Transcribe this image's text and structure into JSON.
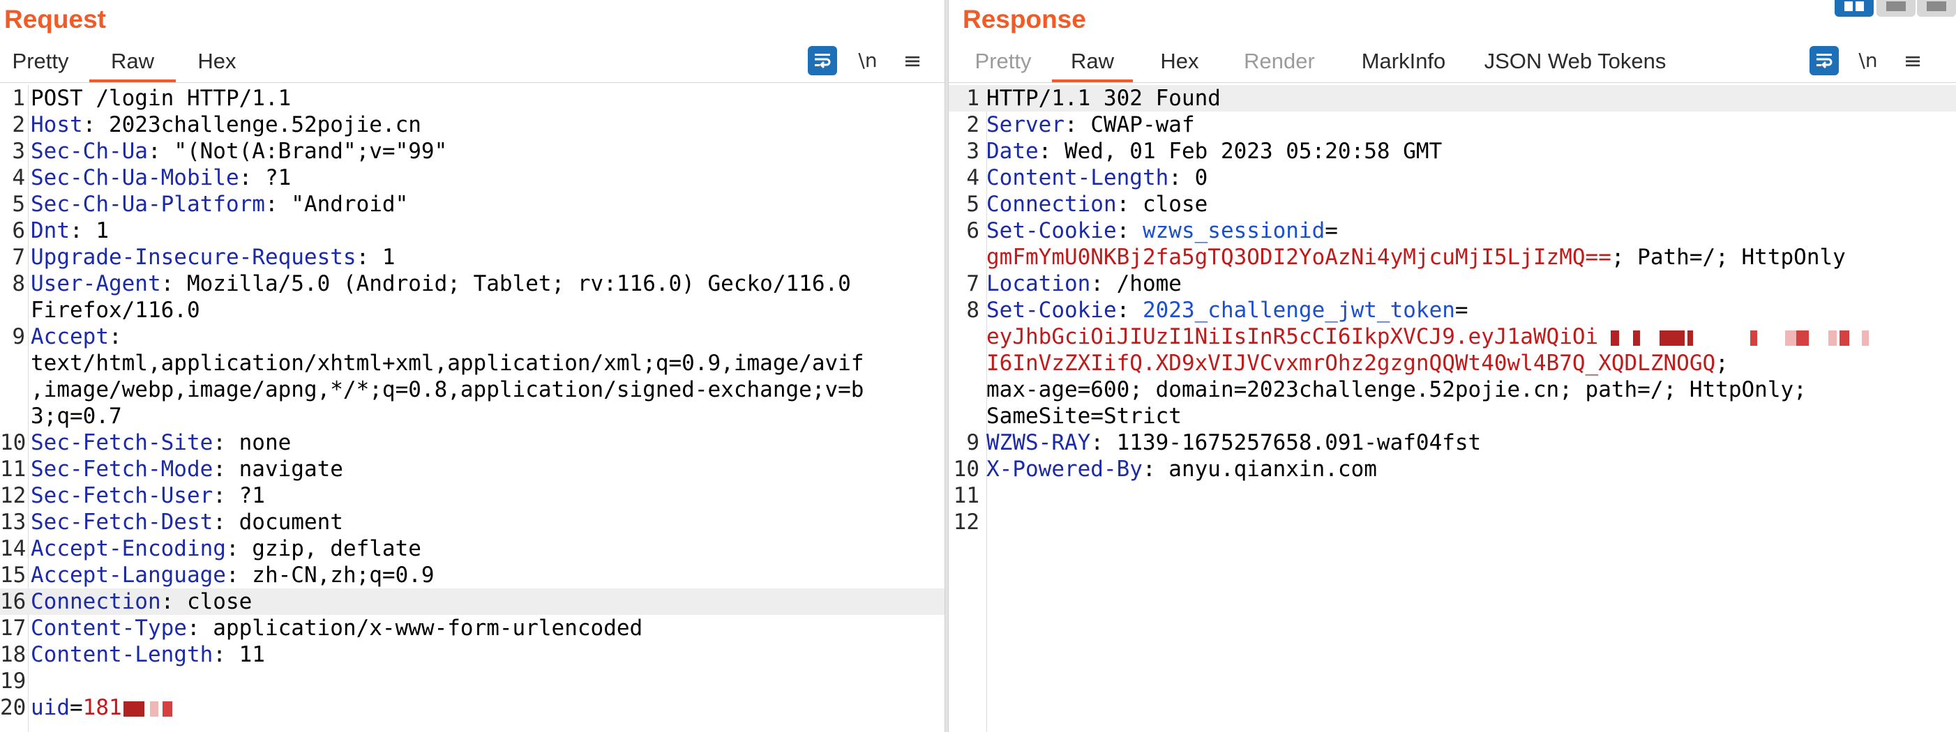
{
  "request": {
    "title": "Request",
    "tabs": [
      {
        "label": "Pretty",
        "active": false
      },
      {
        "label": "Raw",
        "active": true
      },
      {
        "label": "Hex",
        "active": false
      }
    ],
    "newline_label": "\\n",
    "menu_glyph": "≡",
    "request_line": "POST /login HTTP/1.1",
    "headers": [
      {
        "n": 2,
        "name": "Host",
        "value": "2023challenge.52pojie.cn"
      },
      {
        "n": 3,
        "name": "Sec-Ch-Ua",
        "value": "\"(Not(A:Brand\";v=\"99\""
      },
      {
        "n": 4,
        "name": "Sec-Ch-Ua-Mobile",
        "value": "?1"
      },
      {
        "n": 5,
        "name": "Sec-Ch-Ua-Platform",
        "value": "\"Android\""
      },
      {
        "n": 6,
        "name": "Dnt",
        "value": "1"
      },
      {
        "n": 7,
        "name": "Upgrade-Insecure-Requests",
        "value": "1"
      },
      {
        "n": 8,
        "name": "User-Agent",
        "value": "Mozilla/5.0 (Android; Tablet; rv:116.0) Gecko/116.0"
      },
      {
        "n": 9,
        "name": "Accept",
        "value": ""
      },
      {
        "n": 10,
        "name": "Sec-Fetch-Site",
        "value": "none"
      },
      {
        "n": 11,
        "name": "Sec-Fetch-Mode",
        "value": "navigate"
      },
      {
        "n": 12,
        "name": "Sec-Fetch-User",
        "value": "?1"
      },
      {
        "n": 13,
        "name": "Sec-Fetch-Dest",
        "value": "document"
      },
      {
        "n": 14,
        "name": "Accept-Encoding",
        "value": "gzip, deflate"
      },
      {
        "n": 15,
        "name": "Accept-Language",
        "value": "zh-CN,zh;q=0.9"
      },
      {
        "n": 16,
        "name": "Connection",
        "value": "close"
      },
      {
        "n": 17,
        "name": "Content-Type",
        "value": "application/x-www-form-urlencoded"
      },
      {
        "n": 18,
        "name": "Content-Length",
        "value": "11"
      }
    ],
    "ua_continuation": "Firefox/116.0",
    "accept_continuation": [
      "text/html,application/xhtml+xml,application/xml;q=0.9,image/avif",
      ",image/webp,image/apng,*/*;q=0.8,application/signed-exchange;v=b",
      "3;q=0.7"
    ],
    "body_param_name": "uid",
    "body_param_value": "181"
  },
  "response": {
    "title": "Response",
    "tabs": [
      {
        "label": "Pretty",
        "active": false,
        "disabled": true
      },
      {
        "label": "Raw",
        "active": true
      },
      {
        "label": "Hex",
        "active": false
      },
      {
        "label": "Render",
        "active": false,
        "disabled": true
      },
      {
        "label": "MarkInfo",
        "active": false
      },
      {
        "label": "JSON Web Tokens",
        "active": false
      }
    ],
    "newline_label": "\\n",
    "menu_glyph": "≡",
    "status_line": "HTTP/1.1 302 Found",
    "headers": [
      {
        "n": 2,
        "name": "Server",
        "value": "CWAP-waf"
      },
      {
        "n": 3,
        "name": "Date",
        "value": "Wed, 01 Feb 2023 05:20:58 GMT"
      },
      {
        "n": 4,
        "name": "Content-Length",
        "value": "0"
      },
      {
        "n": 5,
        "name": "Connection",
        "value": "close"
      }
    ],
    "cookie1": {
      "n": 6,
      "header": "Set-Cookie",
      "name": "wzws_sessionid",
      "value": "gmFmYmU0NKBj2fa5gTQ3ODI2YoAzNi4yMjcuMjI5LjIzMQ==",
      "attrs": "; Path=/; HttpOnly"
    },
    "location": {
      "n": 7,
      "name": "Location",
      "value": "/home"
    },
    "cookie2": {
      "n": 8,
      "header": "Set-Cookie",
      "name": "2023_challenge_jwt_token",
      "value_line1": "eyJhbGciOiJIUzI1NiIsInR5cCI6IkpXVCJ9.eyJ1aWQiOi",
      "value_line2": "I6InVzZXIifQ.XD9xVIJVCvxmrOhz2gzgnQQWt40wl4B7Q_XQDLZNOGQ",
      "attrs_line2": ";",
      "attrs_line3": "max-age=600; domain=2023challenge.52pojie.cn; path=/; HttpOnly;",
      "attrs_line4": "SameSite=Strict"
    },
    "tail_headers": [
      {
        "n": 9,
        "name": "WZWS-RAY",
        "value": "1139-1675257658.091-waf04fst"
      },
      {
        "n": 10,
        "name": "X-Powered-By",
        "value": "anyu.qianxin.com"
      }
    ]
  },
  "colors": {
    "accent": "#f05b28",
    "header_name": "#1a2aa8",
    "cookie_name": "#1a4fd0",
    "cookie_value": "#c11a1a",
    "toggle_active": "#1d6fb8"
  },
  "icons": [
    "word-wrap-icon",
    "menu-icon",
    "layout-split-icon",
    "layout-rows-icon",
    "layout-single-icon"
  ]
}
